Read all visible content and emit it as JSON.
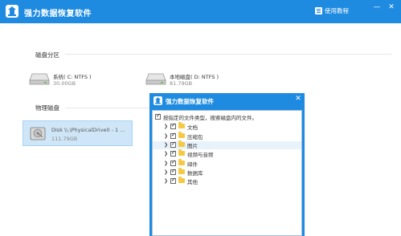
{
  "window": {
    "title": "强力数据恢复软件",
    "help_label": "使用教程",
    "minimize": "—",
    "close": "✕"
  },
  "sections": {
    "partitions_label": "磁盘分区",
    "physical_label": "物理磁盘"
  },
  "partitions": [
    {
      "name": "系统( C: NTFS )",
      "size": "30.00GB"
    },
    {
      "name": "本地磁盘( D: NTFS )",
      "size": "81.79GB"
    }
  ],
  "physical_drives": [
    {
      "name": "Disk \\\\.\\PhysicalDrive0 - 1 ...",
      "size": "111.79GB"
    }
  ],
  "dialog": {
    "title": "强力数据恢复软件",
    "close": "✕",
    "root_label": "按指定的文件类型，搜索磁盘内的文件。",
    "file_types": [
      "文档",
      "压缩包",
      "图片",
      "视频与音频",
      "邮件",
      "数据库",
      "其他"
    ]
  },
  "colors": {
    "accent": "#1e8be0",
    "selected_bg": "#cfe6f8"
  }
}
